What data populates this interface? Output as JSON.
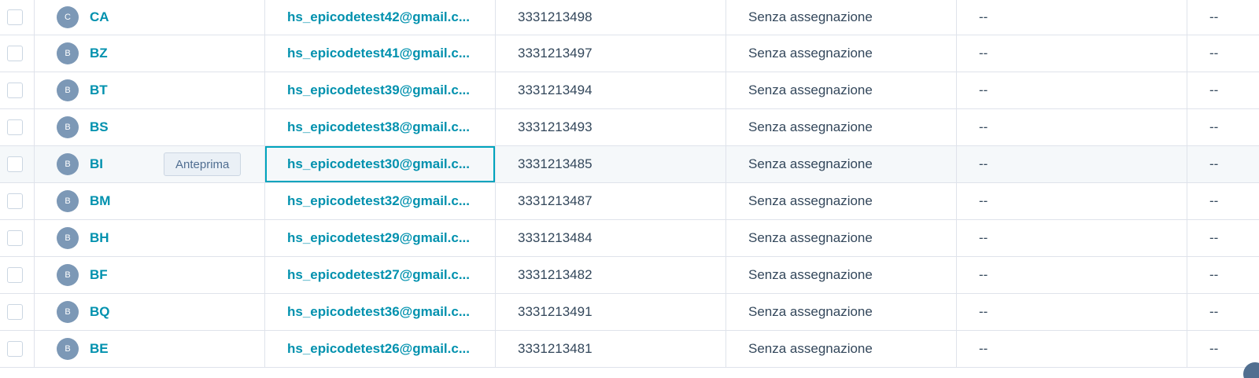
{
  "table": {
    "rows": [
      {
        "initial": "C",
        "name": "CA",
        "email": "hs_epicodetest42@gmail.c...",
        "phone": "3331213498",
        "owner": "Senza assegnazione",
        "col6": "--",
        "col7": "--"
      },
      {
        "initial": "B",
        "name": "BZ",
        "email": "hs_epicodetest41@gmail.c...",
        "phone": "3331213497",
        "owner": "Senza assegnazione",
        "col6": "--",
        "col7": "--"
      },
      {
        "initial": "B",
        "name": "BT",
        "email": "hs_epicodetest39@gmail.c...",
        "phone": "3331213494",
        "owner": "Senza assegnazione",
        "col6": "--",
        "col7": "--"
      },
      {
        "initial": "B",
        "name": "BS",
        "email": "hs_epicodetest38@gmail.c...",
        "phone": "3331213493",
        "owner": "Senza assegnazione",
        "col6": "--",
        "col7": "--"
      },
      {
        "initial": "B",
        "name": "BI",
        "email": "hs_epicodetest30@gmail.c...",
        "phone": "3331213485",
        "owner": "Senza assegnazione",
        "col6": "--",
        "col7": "--",
        "preview_label": "Anteprima"
      },
      {
        "initial": "B",
        "name": "BM",
        "email": "hs_epicodetest32@gmail.c...",
        "phone": "3331213487",
        "owner": "Senza assegnazione",
        "col6": "--",
        "col7": "--"
      },
      {
        "initial": "B",
        "name": "BH",
        "email": "hs_epicodetest29@gmail.c...",
        "phone": "3331213484",
        "owner": "Senza assegnazione",
        "col6": "--",
        "col7": "--"
      },
      {
        "initial": "B",
        "name": "BF",
        "email": "hs_epicodetest27@gmail.c...",
        "phone": "3331213482",
        "owner": "Senza assegnazione",
        "col6": "--",
        "col7": "--"
      },
      {
        "initial": "B",
        "name": "BQ",
        "email": "hs_epicodetest36@gmail.c...",
        "phone": "3331213491",
        "owner": "Senza assegnazione",
        "col6": "--",
        "col7": "--"
      },
      {
        "initial": "B",
        "name": "BE",
        "email": "hs_epicodetest26@gmail.c...",
        "phone": "3331213481",
        "owner": "Senza assegnazione",
        "col6": "--",
        "col7": "--"
      }
    ]
  },
  "colors": {
    "link": "#0091ae",
    "avatar": "#7c98b6",
    "border": "#dfe3eb",
    "focus": "#00a4bd",
    "hover_row": "#f5f8fa",
    "text": "#33475b"
  },
  "icons": {
    "checkbox": "checkbox-icon",
    "avatar": "contact-avatar-icon"
  }
}
